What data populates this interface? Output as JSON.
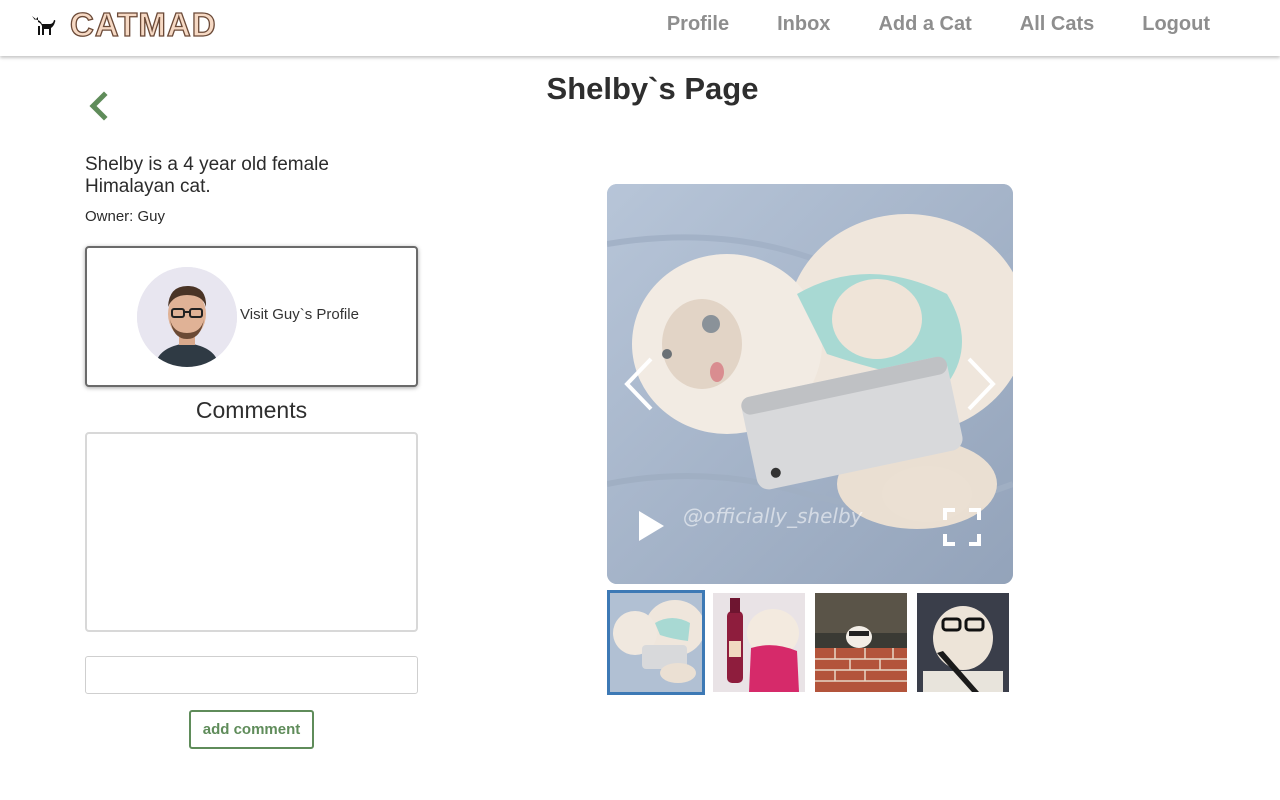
{
  "app": {
    "brand": "CATMAD"
  },
  "nav": {
    "items": [
      {
        "label": "Profile"
      },
      {
        "label": "Inbox"
      },
      {
        "label": "Add a Cat"
      },
      {
        "label": "All Cats"
      },
      {
        "label": "Logout"
      }
    ]
  },
  "page": {
    "title": "Shelby`s Page",
    "description": "Shelby is a 4 year old female Himalayan cat.",
    "owner": "Owner: Guy",
    "owner_card_text": "Visit Guy`s Profile"
  },
  "comments": {
    "heading": "Comments",
    "input_value": "",
    "input_placeholder": "",
    "button_label": "add comment"
  },
  "gallery": {
    "watermark": "@officially_shelby",
    "active_index": 0,
    "thumbnail_count": 4
  },
  "colors": {
    "accent_green": "#5f8c5a",
    "nav_text": "#8e8e8e",
    "thumb_active_border": "#3d79b5"
  }
}
